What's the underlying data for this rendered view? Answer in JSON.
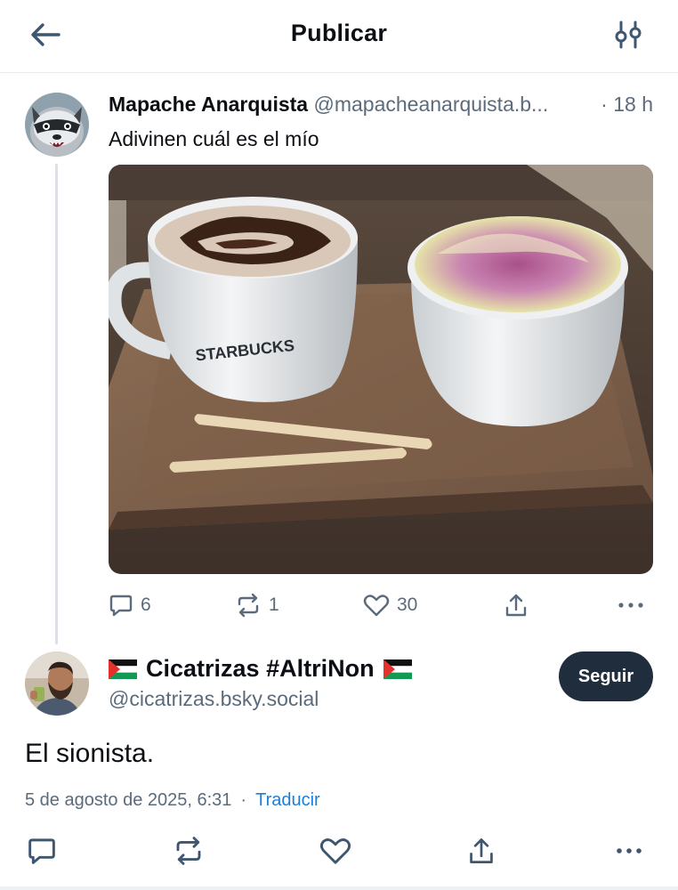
{
  "header": {
    "title": "Publicar",
    "back_icon": "arrow-left-icon",
    "filter_icon": "sliders-icon"
  },
  "parent_post": {
    "author_name": "Mapache Anarquista",
    "author_handle": "@mapacheanarquista.b...",
    "time_sep": "·",
    "time": "18 h",
    "text": "Adivinen cuál es el mío",
    "image_alt": "Dos tazas Starbucks con bebidas cubiertas de crema sobre una bandeja de madera",
    "image_text": "STARBUCKS",
    "replies": "6",
    "reposts": "1",
    "likes": "30"
  },
  "main_post": {
    "author_name": "Cicatrizas #AltriNon",
    "author_handle": "@cicatrizas.bsky.social",
    "follow_label": "Seguir",
    "text": "El sionista.",
    "date": "5 de agosto de 2025, 6:31",
    "meta_sep": "·",
    "translate_label": "Traducir"
  },
  "colors": {
    "muted": "#5b6b7b",
    "accent": "#1c7ed6",
    "follow_bg": "#202d3d"
  }
}
